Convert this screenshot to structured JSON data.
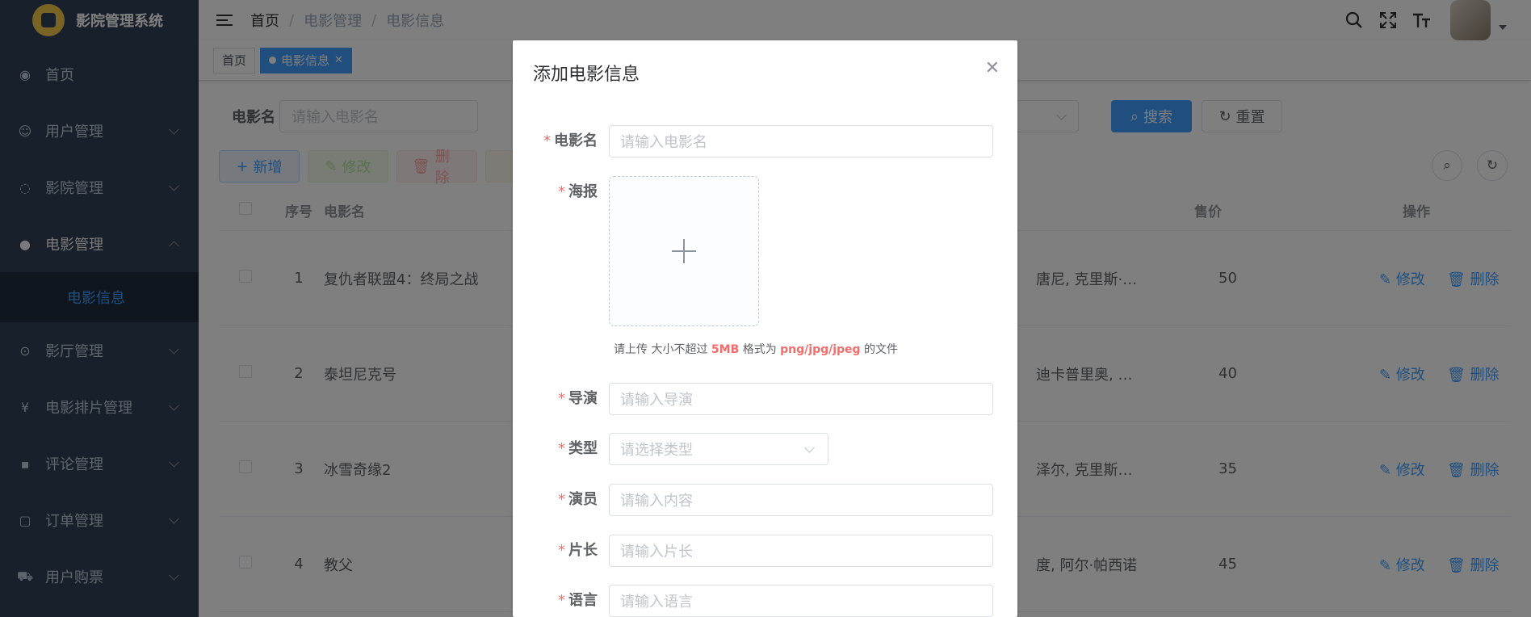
{
  "app": {
    "title": "影院管理系统"
  },
  "sidebar": {
    "items": [
      {
        "label": "首页",
        "icon": "dashboard-icon",
        "expandable": false
      },
      {
        "label": "用户管理",
        "icon": "user-icon",
        "expandable": true
      },
      {
        "label": "影院管理",
        "icon": "cinema-icon",
        "expandable": true
      },
      {
        "label": "电影管理",
        "icon": "github-icon",
        "expandable": true,
        "open": true,
        "sub": "电影信息"
      },
      {
        "label": "影厅管理",
        "icon": "location-icon",
        "expandable": true
      },
      {
        "label": "电影排片管理",
        "icon": "yen-icon",
        "expandable": true
      },
      {
        "label": "评论管理",
        "icon": "comment-icon",
        "expandable": true
      },
      {
        "label": "订单管理",
        "icon": "order-icon",
        "expandable": true
      },
      {
        "label": "用户购票",
        "icon": "cart-icon",
        "expandable": true
      }
    ]
  },
  "breadcrumb": [
    "首页",
    "电影管理",
    "电影信息"
  ],
  "tags": [
    {
      "label": "首页"
    },
    {
      "label": "电影信息",
      "active": true
    }
  ],
  "search": {
    "label": "电影名",
    "placeholder": "请输入电影名",
    "search_btn": "搜索",
    "reset_btn": "重置"
  },
  "toolbar": {
    "add": "新增",
    "edit": "修改",
    "delete": "删除"
  },
  "table": {
    "headers": {
      "index": "序号",
      "name": "电影名",
      "price": "售价",
      "ops": "操作"
    },
    "rows": [
      {
        "index": "1",
        "name": "复仇者联盟4：终局之战",
        "actors": "唐尼, 克里斯·…",
        "price": "50"
      },
      {
        "index": "2",
        "name": "泰坦尼克号",
        "actors": "迪卡普里奥, …",
        "price": "40"
      },
      {
        "index": "3",
        "name": "冰雪奇缘2",
        "actors": "泽尔, 克里斯…",
        "price": "35"
      },
      {
        "index": "4",
        "name": "教父",
        "actors": "度, 阿尔·帕西诺",
        "price": "45"
      }
    ],
    "row_edit": "修改",
    "row_delete": "删除"
  },
  "dialog": {
    "title": "添加电影信息",
    "fields": {
      "name": {
        "label": "电影名",
        "placeholder": "请输入电影名"
      },
      "poster": {
        "label": "海报"
      },
      "director": {
        "label": "导演",
        "placeholder": "请输入导演"
      },
      "type": {
        "label": "类型",
        "placeholder": "请选择类型"
      },
      "actors": {
        "label": "演员",
        "placeholder": "请输入内容"
      },
      "duration": {
        "label": "片长",
        "placeholder": "请输入片长"
      },
      "language": {
        "label": "语言",
        "placeholder": "请输入语言"
      }
    },
    "tip": {
      "pre": "请上传 大小不超过 ",
      "size": "5MB",
      "mid": " 格式为 ",
      "formats": "png/jpg/jpeg",
      "post": " 的文件"
    }
  },
  "colors": {
    "primary": "#409eff",
    "sidebar_bg": "#304156",
    "danger": "#f56c6c",
    "success": "#67c23a"
  }
}
